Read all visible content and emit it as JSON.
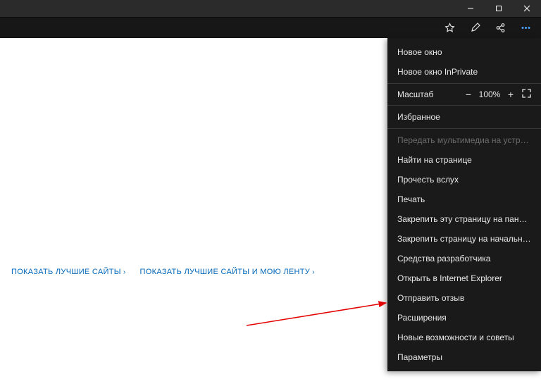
{
  "links": {
    "top_sites": "ПОКАЗАТЬ ЛУЧШИЕ САЙТЫ",
    "top_sites_feed": "ПОКАЗАТЬ ЛУЧШИЕ САЙТЫ И МОЮ ЛЕНТУ"
  },
  "menu": {
    "new_window": "Новое окно",
    "new_inprivate": "Новое окно InPrivate",
    "zoom_label": "Масштаб",
    "zoom_value": "100%",
    "favorites": "Избранное",
    "cast": "Передать мультимедиа на устройство",
    "find": "Найти на странице",
    "read_aloud": "Прочесть вслух",
    "print": "Печать",
    "pin_taskbar": "Закрепить эту страницу на панели задач",
    "pin_start": "Закрепить страницу на начальном экране",
    "dev_tools": "Средства разработчика",
    "open_ie": "Открыть в Internet Explorer",
    "feedback": "Отправить отзыв",
    "extensions": "Расширения",
    "whats_new": "Новые возможности и советы",
    "settings": "Параметры"
  }
}
